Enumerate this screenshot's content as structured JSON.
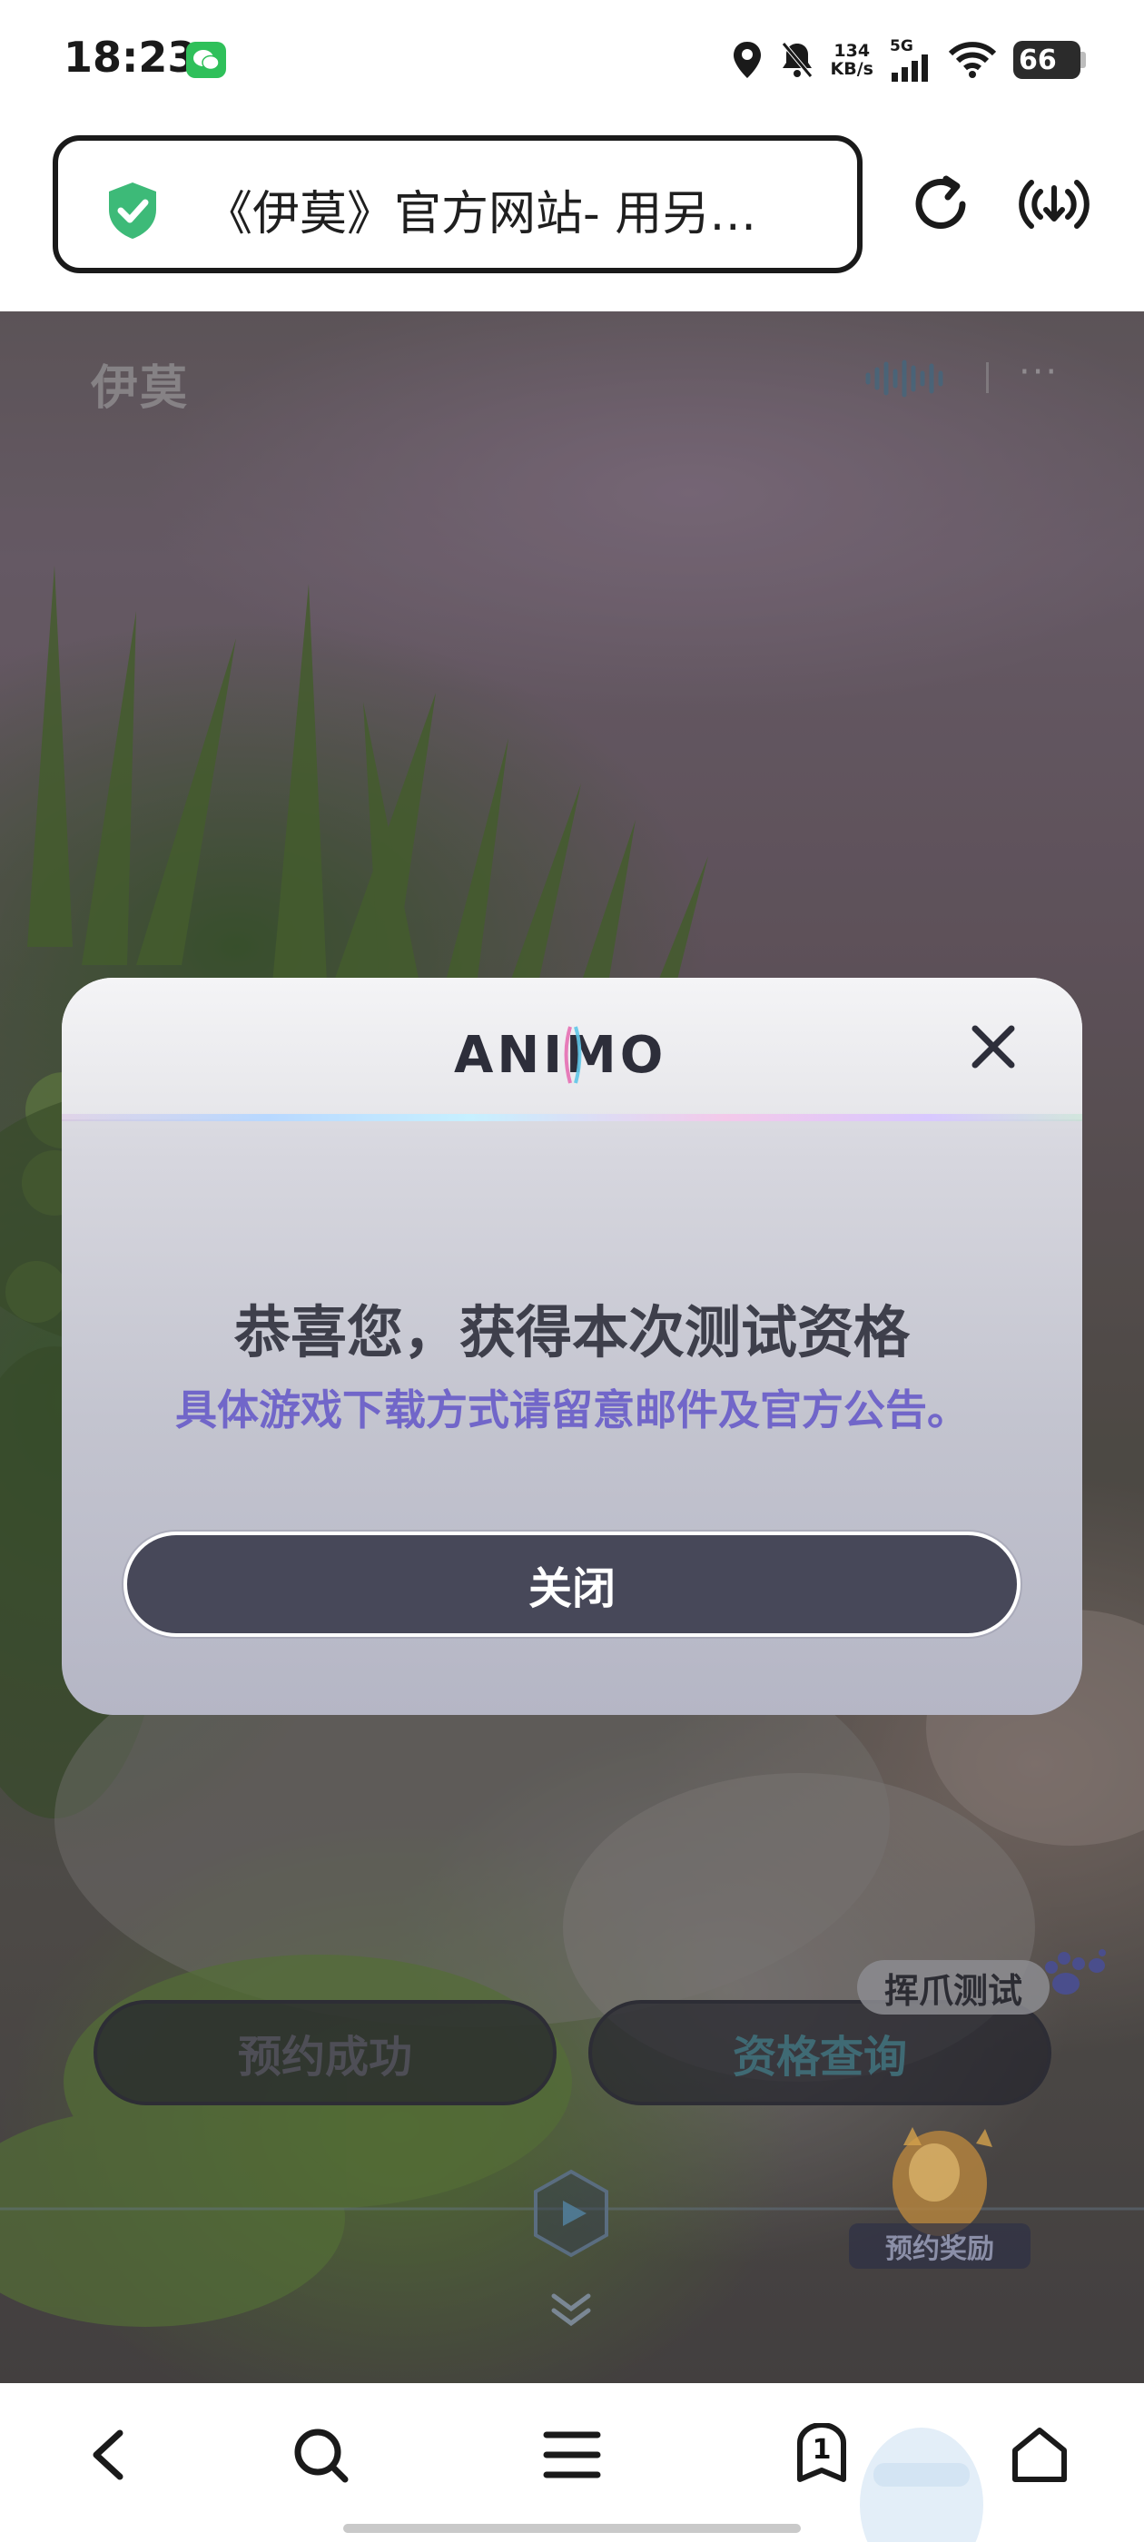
{
  "status_bar": {
    "time": "18:23",
    "net_speed_value": "134",
    "net_speed_unit": "KB/s",
    "network_type": "5G",
    "battery": "66",
    "icons": [
      "wechat-icon",
      "location-icon",
      "bell-muted-icon",
      "signal-icon",
      "wifi-icon",
      "battery-icon"
    ]
  },
  "browser": {
    "url_title": "《伊莫》官方网站- 用另…",
    "icons": [
      "shield-check-icon",
      "reload-icon",
      "radio-download-icon"
    ]
  },
  "web": {
    "site_logo": "伊莫",
    "reserve_button": "预约成功",
    "query_button": "资格查询",
    "test_tag": "挥爪测试",
    "reward_label": "预约奖励",
    "more_dots": "···",
    "icons": [
      "audio-wave-icon",
      "more-icon",
      "paw-icon",
      "play-icon",
      "scroll-down-icon",
      "reward-badge-icon"
    ]
  },
  "modal": {
    "brand": "ANIMO",
    "title": "恭喜您，获得本次测试资格",
    "subtitle": "具体游戏下载方式请留意邮件及官方公告。",
    "close_button": "关闭",
    "icons": [
      "close-icon"
    ]
  },
  "bottom_nav": {
    "tab_count": "1",
    "icons": [
      "back-icon",
      "search-icon",
      "menu-icon",
      "tabs-icon",
      "home-icon"
    ]
  },
  "colors": {
    "accent_purple": "#7166c9",
    "modal_button": "#474859",
    "wechat_green": "#2fc05a",
    "shield_green": "#3dba78"
  }
}
